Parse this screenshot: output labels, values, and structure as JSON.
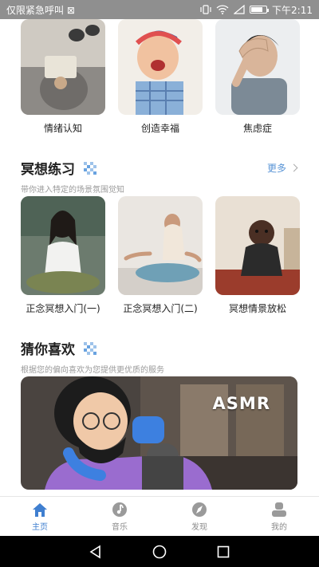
{
  "status_bar": {
    "carrier_text": "仅限紧急呼叫 ⊠",
    "time": "下午2:11"
  },
  "top_cards": [
    {
      "label": "情绪认知"
    },
    {
      "label": "创造幸福"
    },
    {
      "label": "焦虑症"
    }
  ],
  "meditation": {
    "title": "冥想练习",
    "subtitle": "带你进入特定的场景氛围觉知",
    "more_label": "更多",
    "cards": [
      {
        "label": "正念冥想入门(一)"
      },
      {
        "label": "正念冥想入门(二)"
      },
      {
        "label": "冥想情景放松"
      }
    ]
  },
  "recommend": {
    "title": "猜你喜欢",
    "subtitle": "根据您的偏向喜欢为您提供更优质的服务",
    "banner_text": "ASMR"
  },
  "tabs": [
    {
      "label": "主页",
      "icon": "home-icon",
      "active": true
    },
    {
      "label": "音乐",
      "icon": "music-icon",
      "active": false
    },
    {
      "label": "发现",
      "icon": "compass-icon",
      "active": false
    },
    {
      "label": "我的",
      "icon": "person-icon",
      "active": false
    }
  ],
  "colors": {
    "accent": "#3f7fd0",
    "more_link": "#5a95d6",
    "status_bar_bg": "#8f8f8f"
  }
}
